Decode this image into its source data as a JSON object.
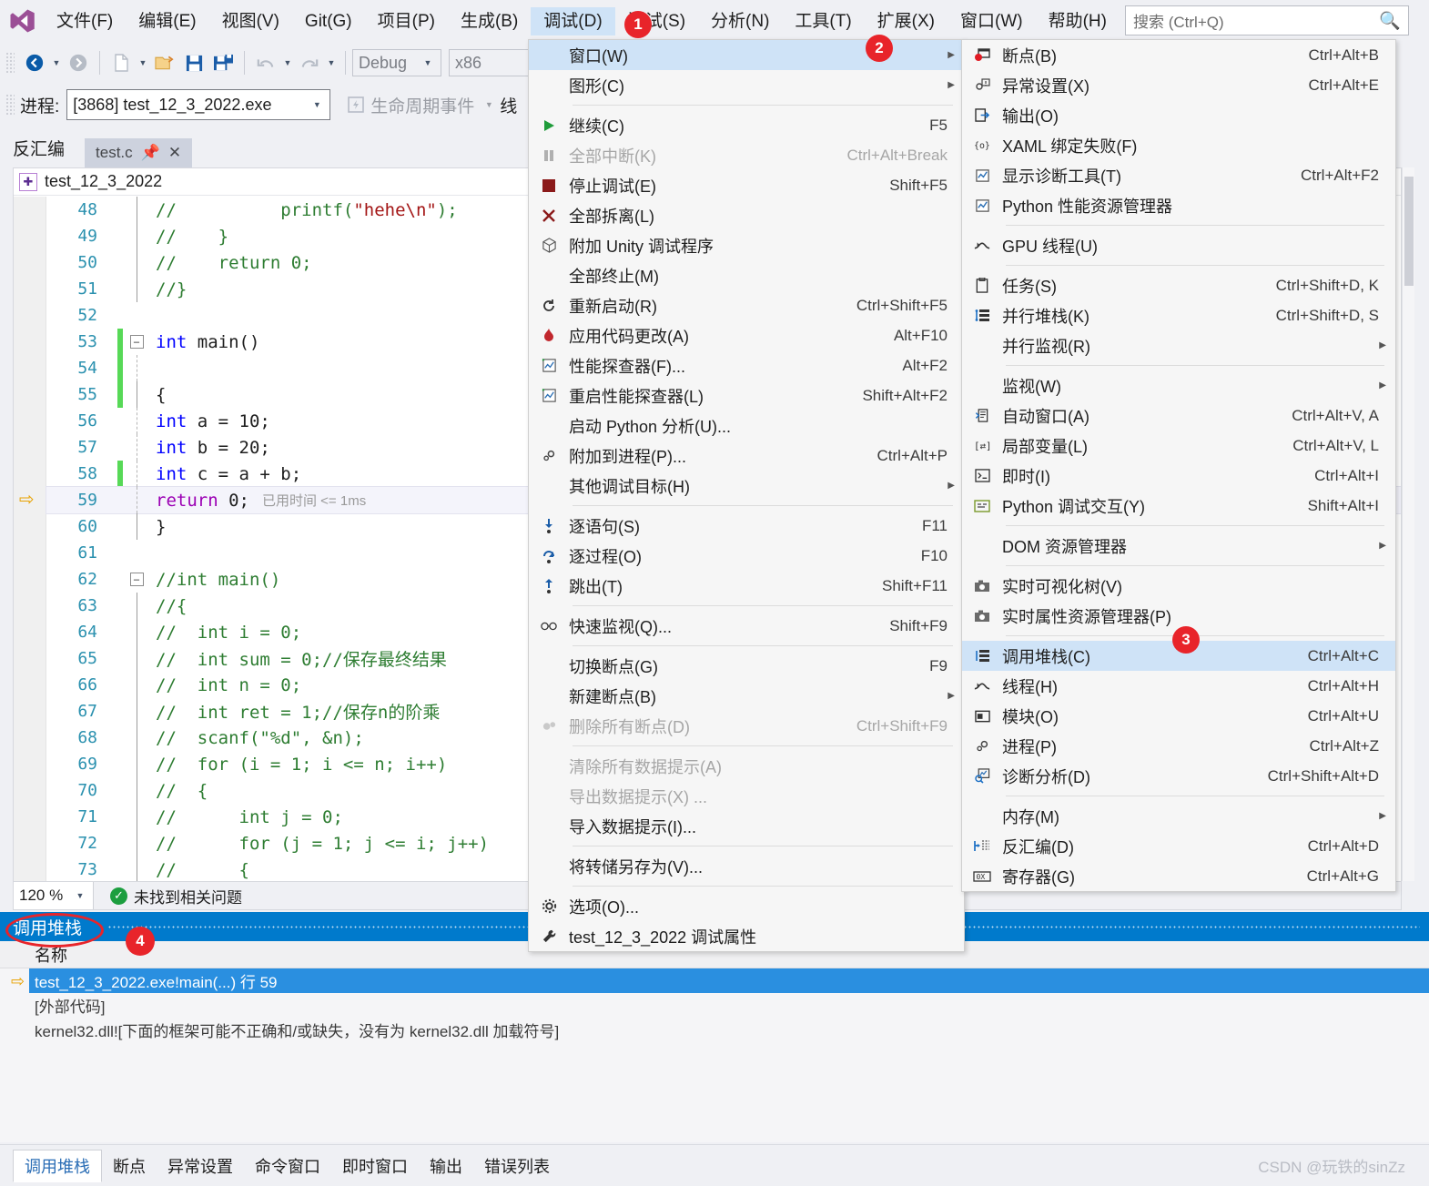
{
  "app": {
    "logo_icon": "visual-studio-logo",
    "menus": [
      "文件(F)",
      "编辑(E)",
      "视图(V)",
      "Git(G)",
      "项目(P)",
      "生成(B)",
      "调试(D)",
      "测试(S)",
      "分析(N)",
      "工具(T)",
      "扩展(X)",
      "窗口(W)",
      "帮助(H)"
    ],
    "active_menu": "调试(D)",
    "search": {
      "placeholder": "搜索 (Ctrl+Q)",
      "icon": "search-icon"
    }
  },
  "toolbar": {
    "back_icon": "navigate-back-icon",
    "forward_icon": "navigate-forward-icon",
    "new_icon": "new-file-icon",
    "open_icon": "open-folder-icon",
    "save_icon": "save-icon",
    "save_all_icon": "save-all-icon",
    "undo_icon": "undo-icon",
    "redo_icon": "redo-icon",
    "config": "Debug",
    "platform": "x86",
    "process_label": "进程:",
    "process_value": "[3868] test_12_3_2022.exe",
    "lifecycle_label": "生命周期事件",
    "thread_label": "线"
  },
  "editor": {
    "tool_window_title": "反汇编",
    "doc_tab": "test.c",
    "pin_icon": "pin-icon",
    "close_icon": "close-icon",
    "nav_project": "test_12_3_2022",
    "nav_icon": "cpp-project-icon",
    "lines": [
      {
        "n": "48",
        "chg": false,
        "fold": "",
        "guide": "solid",
        "indent": 0,
        "parts": [
          {
            "t": "//          printf(",
            "c": "cmt"
          },
          {
            "t": "\"hehe\\n\"",
            "c": "str"
          },
          {
            "t": ");",
            "c": "cmt"
          }
        ]
      },
      {
        "n": "49",
        "chg": false,
        "fold": "",
        "guide": "solid",
        "indent": 0,
        "parts": [
          {
            "t": "//    }",
            "c": "cmt"
          }
        ]
      },
      {
        "n": "50",
        "chg": false,
        "fold": "",
        "guide": "solid",
        "indent": 0,
        "parts": [
          {
            "t": "//    return 0;",
            "c": "cmt"
          }
        ]
      },
      {
        "n": "51",
        "chg": false,
        "fold": "end",
        "guide": "solid",
        "indent": 0,
        "parts": [
          {
            "t": "//}",
            "c": "cmt"
          }
        ]
      },
      {
        "n": "52",
        "chg": false,
        "fold": "",
        "guide": "none",
        "indent": 0,
        "parts": []
      },
      {
        "n": "53",
        "chg": true,
        "fold": "minus",
        "guide": "none",
        "indent": 0,
        "parts": [
          {
            "t": "int",
            "c": "kw"
          },
          {
            "t": " main()",
            "c": "plain"
          }
        ]
      },
      {
        "n": "54",
        "chg": true,
        "fold": "",
        "guide": "dot",
        "indent": 0,
        "parts": []
      },
      {
        "n": "55",
        "chg": true,
        "fold": "",
        "guide": "solid",
        "indent": 0,
        "parts": [
          {
            "t": "{",
            "c": "plain"
          }
        ]
      },
      {
        "n": "56",
        "chg": false,
        "fold": "",
        "guide": "dot",
        "indent": 1,
        "parts": [
          {
            "t": "int",
            "c": "kw"
          },
          {
            "t": " a = ",
            "c": "plain"
          },
          {
            "t": "10",
            "c": "num"
          },
          {
            "t": ";",
            "c": "plain"
          }
        ]
      },
      {
        "n": "57",
        "chg": false,
        "fold": "",
        "guide": "dot",
        "indent": 1,
        "parts": [
          {
            "t": "int",
            "c": "kw"
          },
          {
            "t": " b = ",
            "c": "plain"
          },
          {
            "t": "20",
            "c": "num"
          },
          {
            "t": ";",
            "c": "plain"
          }
        ]
      },
      {
        "n": "58",
        "chg": true,
        "fold": "",
        "guide": "dot",
        "indent": 1,
        "parts": [
          {
            "t": "int",
            "c": "kw"
          },
          {
            "t": " c = a + b;",
            "c": "plain"
          }
        ]
      },
      {
        "n": "59",
        "chg": false,
        "fold": "",
        "guide": "dot",
        "indent": 1,
        "current": true,
        "arrow": true,
        "tip": "已用时间 <= 1ms",
        "parts": [
          {
            "t": "return",
            "c": "kw2"
          },
          {
            "t": " ",
            "c": "plain"
          },
          {
            "t": "0",
            "c": "num"
          },
          {
            "t": ";",
            "c": "plain"
          }
        ]
      },
      {
        "n": "60",
        "chg": false,
        "fold": "end",
        "guide": "solid",
        "indent": 0,
        "parts": [
          {
            "t": "}",
            "c": "plain"
          }
        ]
      },
      {
        "n": "61",
        "chg": false,
        "fold": "",
        "guide": "none",
        "indent": 0,
        "parts": []
      },
      {
        "n": "62",
        "chg": false,
        "fold": "minus",
        "guide": "none",
        "indent": 0,
        "parts": [
          {
            "t": "//int main()",
            "c": "cmt"
          }
        ]
      },
      {
        "n": "63",
        "chg": false,
        "fold": "",
        "guide": "solid",
        "indent": 0,
        "parts": [
          {
            "t": "//{",
            "c": "cmt"
          }
        ]
      },
      {
        "n": "64",
        "chg": false,
        "fold": "",
        "guide": "solid",
        "indent": 0,
        "parts": [
          {
            "t": "//  int i = 0;",
            "c": "cmt"
          }
        ]
      },
      {
        "n": "65",
        "chg": false,
        "fold": "",
        "guide": "solid",
        "indent": 0,
        "parts": [
          {
            "t": "//  int sum = 0;//保存最终结果",
            "c": "cmt"
          }
        ]
      },
      {
        "n": "66",
        "chg": false,
        "fold": "",
        "guide": "solid",
        "indent": 0,
        "parts": [
          {
            "t": "//  int n = 0;",
            "c": "cmt"
          }
        ]
      },
      {
        "n": "67",
        "chg": false,
        "fold": "",
        "guide": "solid",
        "indent": 0,
        "parts": [
          {
            "t": "//  int ret = 1;//保存n的阶乘",
            "c": "cmt"
          }
        ]
      },
      {
        "n": "68",
        "chg": false,
        "fold": "",
        "guide": "solid",
        "indent": 0,
        "parts": [
          {
            "t": "//  scanf(\"%d\", &n);",
            "c": "cmt"
          }
        ]
      },
      {
        "n": "69",
        "chg": false,
        "fold": "",
        "guide": "solid",
        "indent": 0,
        "parts": [
          {
            "t": "//  for (i = 1; i <= n; i++)",
            "c": "cmt"
          }
        ]
      },
      {
        "n": "70",
        "chg": false,
        "fold": "",
        "guide": "solid",
        "indent": 0,
        "parts": [
          {
            "t": "//  {",
            "c": "cmt"
          }
        ]
      },
      {
        "n": "71",
        "chg": false,
        "fold": "",
        "guide": "solid",
        "indent": 0,
        "parts": [
          {
            "t": "//      int j = 0;",
            "c": "cmt"
          }
        ]
      },
      {
        "n": "72",
        "chg": false,
        "fold": "",
        "guide": "solid",
        "indent": 0,
        "parts": [
          {
            "t": "//      for (j = 1; j <= i; j++)",
            "c": "cmt"
          }
        ]
      },
      {
        "n": "73",
        "chg": false,
        "fold": "",
        "guide": "solid",
        "indent": 0,
        "parts": [
          {
            "t": "//      {",
            "c": "cmt"
          }
        ]
      }
    ]
  },
  "status": {
    "zoom": "120 %",
    "issue_icon": "check-circle-icon",
    "issue_text": "未找到相关问题"
  },
  "callstack": {
    "title": "调用堆栈",
    "column": "名称",
    "rows": [
      {
        "text": "test_12_3_2022.exe!main(...) 行 59",
        "selected": true,
        "arrow": true
      },
      {
        "text": "[外部代码]",
        "selected": false,
        "arrow": false
      },
      {
        "text": "kernel32.dll![下面的框架可能不正确和/或缺失，没有为 kernel32.dll 加载符号]",
        "selected": false,
        "arrow": false
      }
    ]
  },
  "bottom_tabs": {
    "items": [
      "调用堆栈",
      "断点",
      "异常设置",
      "命令窗口",
      "即时窗口",
      "输出",
      "错误列表"
    ],
    "active": "调用堆栈"
  },
  "watermark": "CSDN @玩铁的sinZz",
  "debug_menu": {
    "items": [
      {
        "icon": "",
        "label": "窗口(W)",
        "key": "",
        "submenu": true,
        "highlight": true
      },
      {
        "icon": "",
        "label": "图形(C)",
        "key": "",
        "submenu": true
      },
      {
        "sep": true
      },
      {
        "icon": "play-icon",
        "label": "继续(C)",
        "key": "F5"
      },
      {
        "icon": "pause-icon",
        "label": "全部中断(K)",
        "key": "Ctrl+Alt+Break",
        "disabled": true
      },
      {
        "icon": "stop-icon",
        "label": "停止调试(E)",
        "key": "Shift+F5"
      },
      {
        "icon": "detach-icon",
        "label": "全部拆离(L)",
        "key": ""
      },
      {
        "icon": "unity-cube-icon",
        "label": "附加 Unity 调试程序",
        "key": ""
      },
      {
        "icon": "",
        "label": "全部终止(M)",
        "key": ""
      },
      {
        "icon": "restart-icon",
        "label": "重新启动(R)",
        "key": "Ctrl+Shift+F5"
      },
      {
        "icon": "flame-icon",
        "label": "应用代码更改(A)",
        "key": "Alt+F10"
      },
      {
        "icon": "perf-icon",
        "label": "性能探查器(F)...",
        "key": "Alt+F2"
      },
      {
        "icon": "perf-icon",
        "label": "重启性能探查器(L)",
        "key": "Shift+Alt+F2"
      },
      {
        "icon": "",
        "label": "启动 Python 分析(U)...",
        "key": ""
      },
      {
        "icon": "gears-icon",
        "label": "附加到进程(P)...",
        "key": "Ctrl+Alt+P"
      },
      {
        "icon": "",
        "label": "其他调试目标(H)",
        "key": "",
        "submenu": true
      },
      {
        "sep": true
      },
      {
        "icon": "step-into-icon",
        "label": "逐语句(S)",
        "key": "F11"
      },
      {
        "icon": "step-over-icon",
        "label": "逐过程(O)",
        "key": "F10"
      },
      {
        "icon": "step-out-icon",
        "label": "跳出(T)",
        "key": "Shift+F11"
      },
      {
        "sep": true
      },
      {
        "icon": "quickwatch-icon",
        "label": "快速监视(Q)...",
        "key": "Shift+F9"
      },
      {
        "sep": true
      },
      {
        "icon": "",
        "label": "切换断点(G)",
        "key": "F9"
      },
      {
        "icon": "",
        "label": "新建断点(B)",
        "key": "",
        "submenu": true
      },
      {
        "icon": "delete-breakpoints-icon",
        "label": "删除所有断点(D)",
        "key": "Ctrl+Shift+F9",
        "disabled": true
      },
      {
        "sep": true
      },
      {
        "icon": "",
        "label": "清除所有数据提示(A)",
        "key": "",
        "disabled": true
      },
      {
        "icon": "",
        "label": "导出数据提示(X) ...",
        "key": "",
        "disabled": true
      },
      {
        "icon": "",
        "label": "导入数据提示(I)...",
        "key": ""
      },
      {
        "sep": true
      },
      {
        "icon": "",
        "label": "将转储另存为(V)...",
        "key": ""
      },
      {
        "sep": true
      },
      {
        "icon": "gear-icon",
        "label": "选项(O)...",
        "key": ""
      },
      {
        "icon": "wrench-icon",
        "label": "test_12_3_2022 调试属性",
        "key": ""
      }
    ]
  },
  "window_submenu": {
    "items": [
      {
        "icon": "breakpoint-window-icon",
        "label": "断点(B)",
        "key": "Ctrl+Alt+B"
      },
      {
        "icon": "exception-settings-icon",
        "label": "异常设置(X)",
        "key": "Ctrl+Alt+E"
      },
      {
        "icon": "output-icon",
        "label": "输出(O)",
        "key": ""
      },
      {
        "icon": "xaml-binding-icon",
        "label": "XAML 绑定失败(F)",
        "key": ""
      },
      {
        "icon": "diagnostic-tools-icon",
        "label": "显示诊断工具(T)",
        "key": "Ctrl+Alt+F2"
      },
      {
        "icon": "diagnostic-tools-icon",
        "label": "Python 性能资源管理器",
        "key": ""
      },
      {
        "sep": true
      },
      {
        "icon": "threads-icon",
        "label": "GPU 线程(U)",
        "key": ""
      },
      {
        "sep": true
      },
      {
        "icon": "tasks-icon",
        "label": "任务(S)",
        "key": "Ctrl+Shift+D, K"
      },
      {
        "icon": "parallel-stacks-icon",
        "label": "并行堆栈(K)",
        "key": "Ctrl+Shift+D, S"
      },
      {
        "icon": "",
        "label": "并行监视(R)",
        "key": "",
        "submenu": true
      },
      {
        "sep": true
      },
      {
        "icon": "",
        "label": "监视(W)",
        "key": "",
        "submenu": true
      },
      {
        "icon": "autos-icon",
        "label": "自动窗口(A)",
        "key": "Ctrl+Alt+V, A"
      },
      {
        "icon": "locals-icon",
        "label": "局部变量(L)",
        "key": "Ctrl+Alt+V, L"
      },
      {
        "icon": "immediate-icon",
        "label": "即时(I)",
        "key": "Ctrl+Alt+I"
      },
      {
        "icon": "python-interactive-icon",
        "label": "Python 调试交互(Y)",
        "key": "Shift+Alt+I"
      },
      {
        "sep": true
      },
      {
        "icon": "",
        "label": "DOM 资源管理器",
        "key": "",
        "submenu": true
      },
      {
        "sep": true
      },
      {
        "icon": "camera-icon",
        "label": "实时可视化树(V)",
        "key": ""
      },
      {
        "icon": "camera-icon",
        "label": "实时属性资源管理器(P)",
        "key": ""
      },
      {
        "sep": true
      },
      {
        "icon": "callstack-icon",
        "label": "调用堆栈(C)",
        "key": "Ctrl+Alt+C",
        "highlight": true
      },
      {
        "icon": "threads-icon",
        "label": "线程(H)",
        "key": "Ctrl+Alt+H"
      },
      {
        "icon": "modules-icon",
        "label": "模块(O)",
        "key": "Ctrl+Alt+U"
      },
      {
        "icon": "gears-icon",
        "label": "进程(P)",
        "key": "Ctrl+Alt+Z"
      },
      {
        "icon": "diagnostic-analysis-icon",
        "label": "诊断分析(D)",
        "key": "Ctrl+Shift+Alt+D"
      },
      {
        "sep": true
      },
      {
        "icon": "",
        "label": "内存(M)",
        "key": "",
        "submenu": true
      },
      {
        "icon": "disassembly-icon",
        "label": "反汇编(D)",
        "key": "Ctrl+Alt+D"
      },
      {
        "icon": "registers-icon",
        "label": "寄存器(G)",
        "key": "Ctrl+Alt+G"
      }
    ]
  },
  "annotations": {
    "b1": "1",
    "b2": "2",
    "b3": "3",
    "b4": "4"
  }
}
